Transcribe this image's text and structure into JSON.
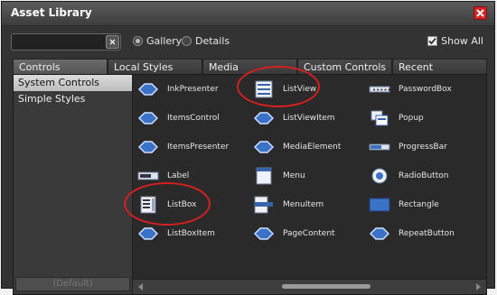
{
  "window": {
    "title": "Asset Library",
    "close_icon": "close-icon"
  },
  "search": {
    "value": "",
    "placeholder": ""
  },
  "view_options": [
    {
      "label": "Gallery",
      "selected": true
    },
    {
      "label": "Details",
      "selected": false
    }
  ],
  "show_all": {
    "label": "Show All",
    "checked": true
  },
  "tabs": [
    {
      "label": "Controls",
      "active": true
    },
    {
      "label": "Local Styles",
      "active": false
    },
    {
      "label": "Media",
      "active": false
    },
    {
      "label": "Custom Controls",
      "active": false
    },
    {
      "label": "Recent",
      "active": false
    }
  ],
  "categories": [
    {
      "label": "System Controls",
      "selected": true
    },
    {
      "label": "Simple Styles",
      "selected": false
    }
  ],
  "default_button": {
    "label": "(Default)"
  },
  "assets": [
    {
      "label": "InkPresenter",
      "icon": "blue-diamond-icon"
    },
    {
      "label": "ListView",
      "icon": "listview-icon"
    },
    {
      "label": "PasswordBox",
      "icon": "passwordbox-icon"
    },
    {
      "label": "ItemsControl",
      "icon": "blue-diamond-icon"
    },
    {
      "label": "ListViewItem",
      "icon": "blue-diamond-icon"
    },
    {
      "label": "Popup",
      "icon": "popup-icon"
    },
    {
      "label": "ItemsPresenter",
      "icon": "blue-diamond-icon"
    },
    {
      "label": "MediaElement",
      "icon": "blue-diamond-icon"
    },
    {
      "label": "ProgressBar",
      "icon": "progressbar-icon"
    },
    {
      "label": "Label",
      "icon": "label-icon"
    },
    {
      "label": "Menu",
      "icon": "menu-icon"
    },
    {
      "label": "RadioButton",
      "icon": "radiobutton-icon"
    },
    {
      "label": "ListBox",
      "icon": "listbox-icon"
    },
    {
      "label": "MenuItem",
      "icon": "menuitem-icon"
    },
    {
      "label": "Rectangle",
      "icon": "rectangle-icon"
    },
    {
      "label": "ListBoxItem",
      "icon": "blue-diamond-icon"
    },
    {
      "label": "PageContent",
      "icon": "blue-diamond-icon"
    },
    {
      "label": "RepeatButton",
      "icon": "blue-diamond-icon"
    }
  ],
  "colors": {
    "highlight": "#d62020",
    "icon_blue": "#3a72c8"
  }
}
